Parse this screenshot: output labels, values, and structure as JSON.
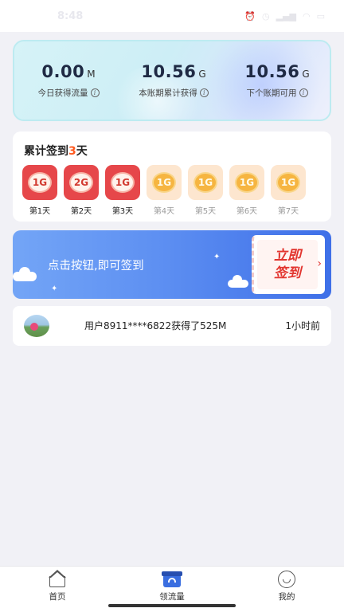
{
  "status_bar": {
    "time": "8:48",
    "icons": [
      "alarm-icon",
      "clock-icon",
      "signal-icon",
      "wifi-icon",
      "battery-icon"
    ]
  },
  "stats": [
    {
      "value": "0.00",
      "unit": "M",
      "label": "今日获得流量"
    },
    {
      "value": "10.56",
      "unit": "G",
      "label": "本账期累计获得"
    },
    {
      "value": "10.56",
      "unit": "G",
      "label": "下个账期可用"
    }
  ],
  "signin": {
    "title_prefix": "累计签到",
    "count": "3",
    "title_suffix": "天",
    "days": [
      {
        "reward": "1G",
        "label": "第1天",
        "done": true
      },
      {
        "reward": "2G",
        "label": "第2天",
        "done": true
      },
      {
        "reward": "1G",
        "label": "第3天",
        "done": true
      },
      {
        "reward": "1G",
        "label": "第4天",
        "done": false
      },
      {
        "reward": "1G",
        "label": "第5天",
        "done": false
      },
      {
        "reward": "1G",
        "label": "第6天",
        "done": false
      },
      {
        "reward": "1G",
        "label": "第7天",
        "done": false
      }
    ]
  },
  "banner": {
    "text": "点击按钮,即可签到",
    "button_line1": "立即",
    "button_line2": "签到"
  },
  "activity": {
    "text": "用户8911****6822获得了525M",
    "time": "1小时前"
  },
  "bottom_nav": [
    {
      "label": "首页",
      "icon": "home-icon"
    },
    {
      "label": "领流量",
      "icon": "gift-icon"
    },
    {
      "label": "我的",
      "icon": "profile-icon"
    }
  ],
  "colors": {
    "accent_red": "#e6474a",
    "accent_orange": "#ff5a1f",
    "banner_blue": "#5e90f2"
  }
}
